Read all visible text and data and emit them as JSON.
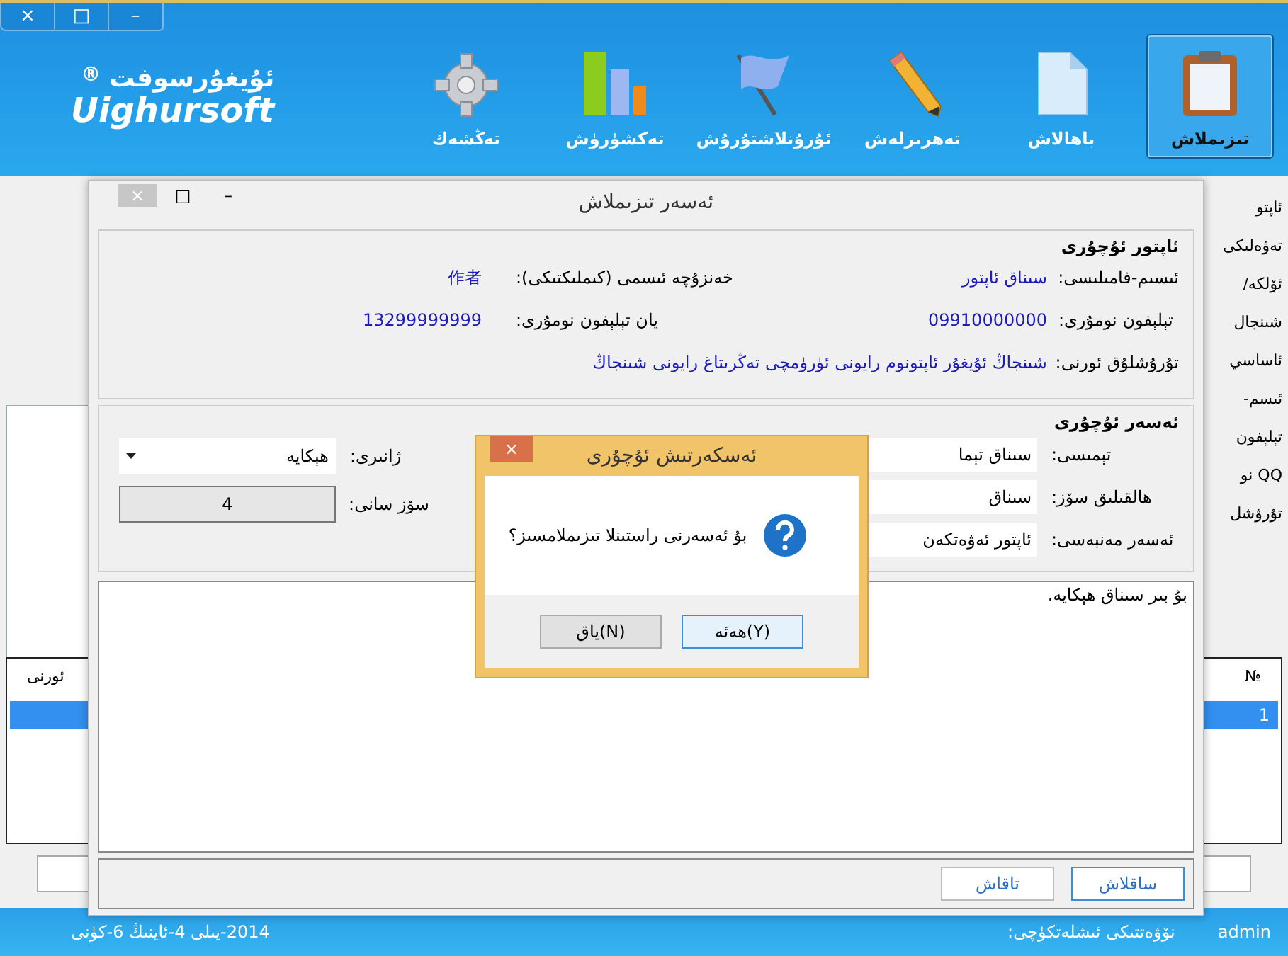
{
  "window_controls": [
    "–",
    "□",
    "×"
  ],
  "logo": {
    "name": "ئۇيغۇرسوفت",
    "mark": "®",
    "latin": "Uighursoft"
  },
  "toolbar": [
    {
      "label": "تىزىملاش",
      "kind": "clipboard",
      "selected": true
    },
    {
      "label": "باھالاش",
      "kind": "document",
      "selected": false
    },
    {
      "label": "تەھرىرلەش",
      "kind": "pencil",
      "selected": false
    },
    {
      "label": "ئۇرۇنلاشتۇرۇش",
      "kind": "flag",
      "selected": false
    },
    {
      "label": "تەكشۈرۈش",
      "kind": "chart",
      "selected": false
    },
    {
      "label": "تەڭشەك",
      "kind": "gear",
      "selected": false
    }
  ],
  "side_labels": [
    "ئاپتو",
    "تەۋەلىكى",
    "ئۆلكە/",
    "شىنجال",
    "ئاساسي",
    "ئىسم-",
    "تېلېفون",
    "QQ نو",
    "تۇرۋشل"
  ],
  "table": {
    "columns": [
      "№",
      "ئورنى"
    ],
    "rows": [
      {
        "cells": [
          "1",
          ""
        ],
        "selected": true
      }
    ]
  },
  "status_bar": {
    "user_label": "نۆۋەتتىكى ئىشلەتكۈچى:",
    "user": "admin",
    "date": "2014-يىلى 4-ئاينىڭ 6-كۈنى"
  },
  "dialog": {
    "controls": [
      "–",
      "□",
      "×"
    ],
    "title": "ئەسەر تىزىملاش",
    "author_section": {
      "title": "ئاپتور ئۇچۇرى",
      "rows": [
        [
          {
            "label": "ئىسىم-فامىلىسى:",
            "value": "سىناق ئاپتور"
          },
          {
            "label": "خەنزۇچە ئىسمى (كىملىكتىكى):",
            "value": "作者"
          }
        ],
        [
          {
            "label": "تېلېفون نومۇرى:",
            "value": "09910000000"
          },
          {
            "label": "يان تېلېفون نومۇرى:",
            "value": "13299999999"
          }
        ],
        [
          {
            "label": "تۇرۇشلۇق ئورنى:",
            "value": "شىنجاڭ ئۇيغۇر ئاپتونوم رايونى  ئۈرۈمچى  تەڭرىتاغ رايونى  شىنجاڭ"
          }
        ]
      ]
    },
    "work_section": {
      "title": "ئەسەر ئۇچۇرى",
      "topic": {
        "label": "تېمىسى:",
        "value": "سىناق تېما"
      },
      "keyword": {
        "label": "ھالقىلىق سۆز:",
        "value": "سىناق"
      },
      "source": {
        "label": "ئەسەر مەنبەسى:",
        "value": "ئاپتور ئەۋەتكەن"
      },
      "genre": {
        "label": "ژانىرى:",
        "value": "ھېكايە"
      },
      "word_count": {
        "label": "سۆز سانى:",
        "value": "4"
      }
    },
    "content": "بۇ بىر سىناق ھېكايە.",
    "buttons": [
      {
        "label": "ساقلاش",
        "default": true
      },
      {
        "label": "تاقاش",
        "default": false
      }
    ]
  },
  "message_box": {
    "close": "×",
    "title": "ئەسكەرتىش ئۇچۇرى",
    "message": "بۇ ئەسەرنى راستىنلا تىزىملامسىز؟",
    "buttons": [
      {
        "label": "ھەئە(Y)",
        "default": true
      },
      {
        "label": "ياق(N)",
        "default": false
      }
    ]
  }
}
